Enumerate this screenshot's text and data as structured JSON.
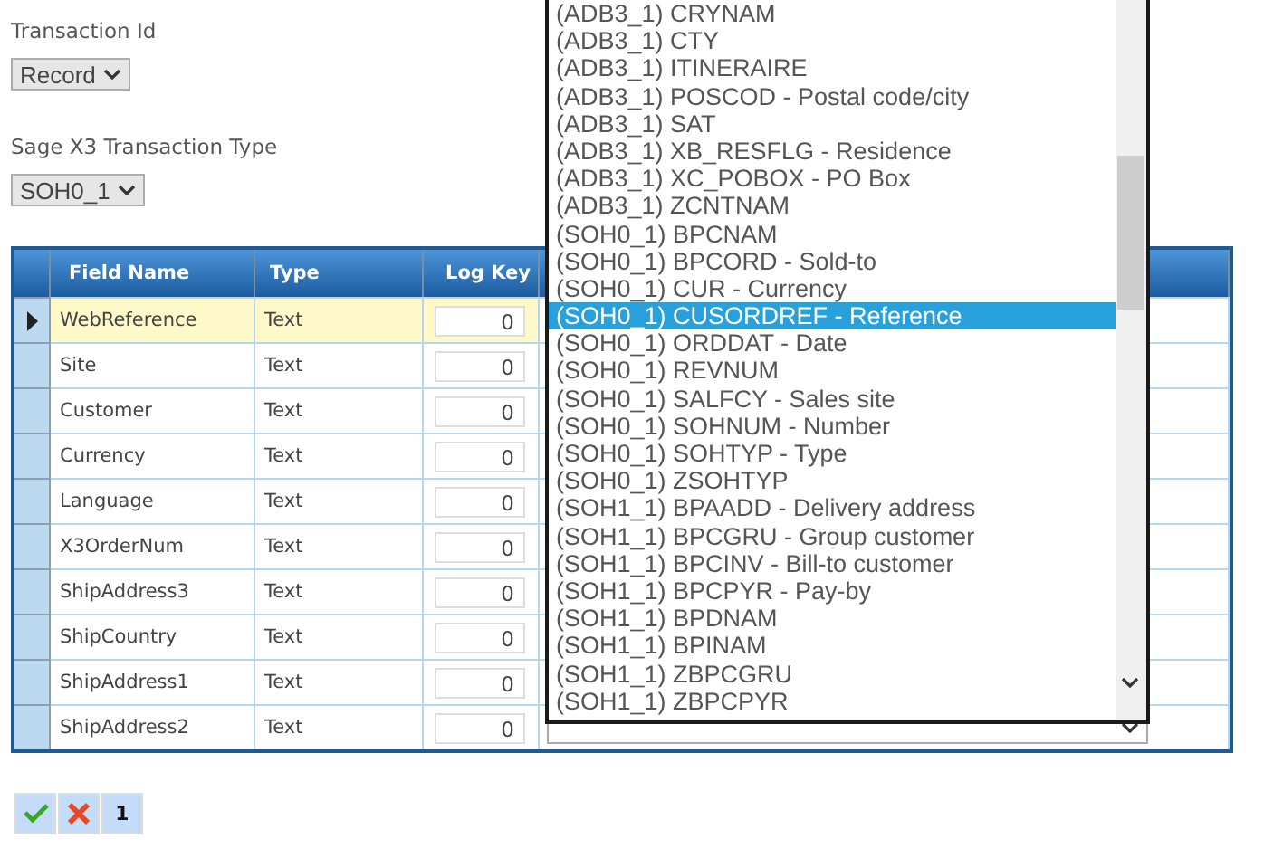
{
  "transaction_id": {
    "label": "Transaction Id",
    "value": "Record"
  },
  "transaction_type": {
    "label": "Sage X3 Transaction Type",
    "value": "SOH0_1"
  },
  "grid": {
    "columns": [
      "Field Name",
      "Type",
      "Log Key"
    ],
    "rows": [
      {
        "field_name": "WebReference",
        "type": "Text",
        "log_key": "0",
        "selected": true
      },
      {
        "field_name": "Site",
        "type": "Text",
        "log_key": "0",
        "selected": false
      },
      {
        "field_name": "Customer",
        "type": "Text",
        "log_key": "0",
        "selected": false
      },
      {
        "field_name": "Currency",
        "type": "Text",
        "log_key": "0",
        "selected": false
      },
      {
        "field_name": "Language",
        "type": "Text",
        "log_key": "0",
        "selected": false
      },
      {
        "field_name": "X3OrderNum",
        "type": "Text",
        "log_key": "0",
        "selected": false
      },
      {
        "field_name": "ShipAddress3",
        "type": "Text",
        "log_key": "0",
        "selected": false
      },
      {
        "field_name": "ShipCountry",
        "type": "Text",
        "log_key": "0",
        "selected": false
      },
      {
        "field_name": "ShipAddress1",
        "type": "Text",
        "log_key": "0",
        "selected": false
      },
      {
        "field_name": "ShipAddress2",
        "type": "Text",
        "log_key": "0",
        "selected": false
      }
    ]
  },
  "dropdown_list": {
    "options": [
      {
        "label": "(ADB3_1) CRYNAM",
        "selected": false
      },
      {
        "label": "(ADB3_1) CTY",
        "selected": false
      },
      {
        "label": "(ADB3_1) ITINERAIRE",
        "selected": false
      },
      {
        "label": "(ADB3_1) POSCOD - Postal code/city",
        "selected": false
      },
      {
        "label": "(ADB3_1) SAT",
        "selected": false
      },
      {
        "label": "(ADB3_1) XB_RESFLG - Residence",
        "selected": false
      },
      {
        "label": "(ADB3_1) XC_POBOX - PO Box",
        "selected": false
      },
      {
        "label": "(ADB3_1) ZCNTNAM",
        "selected": false
      },
      {
        "label": "(SOH0_1) BPCNAM",
        "selected": false
      },
      {
        "label": "(SOH0_1) BPCORD - Sold-to",
        "selected": false
      },
      {
        "label": "(SOH0_1) CUR - Currency",
        "selected": false
      },
      {
        "label": "(SOH0_1) CUSORDREF - Reference",
        "selected": true
      },
      {
        "label": "(SOH0_1) ORDDAT - Date",
        "selected": false
      },
      {
        "label": "(SOH0_1) REVNUM",
        "selected": false
      },
      {
        "label": "(SOH0_1) SALFCY - Sales site",
        "selected": false
      },
      {
        "label": "(SOH0_1) SOHNUM - Number",
        "selected": false
      },
      {
        "label": "(SOH0_1) SOHTYP - Type",
        "selected": false
      },
      {
        "label": "(SOH0_1) ZSOHTYP",
        "selected": false
      },
      {
        "label": "(SOH1_1) BPAADD - Delivery address",
        "selected": false
      },
      {
        "label": "(SOH1_1) BPCGRU - Group customer",
        "selected": false
      },
      {
        "label": "(SOH1_1) BPCINV - Bill-to customer",
        "selected": false
      },
      {
        "label": "(SOH1_1) BPCPYR - Pay-by",
        "selected": false
      },
      {
        "label": "(SOH1_1) BPDNAM",
        "selected": false
      },
      {
        "label": "(SOH1_1) BPINAM",
        "selected": false
      },
      {
        "label": "(SOH1_1) ZBPCGRU",
        "selected": false
      },
      {
        "label": "(SOH1_1) ZBPCPYR",
        "selected": false
      }
    ]
  },
  "pager": {
    "page": "1"
  }
}
